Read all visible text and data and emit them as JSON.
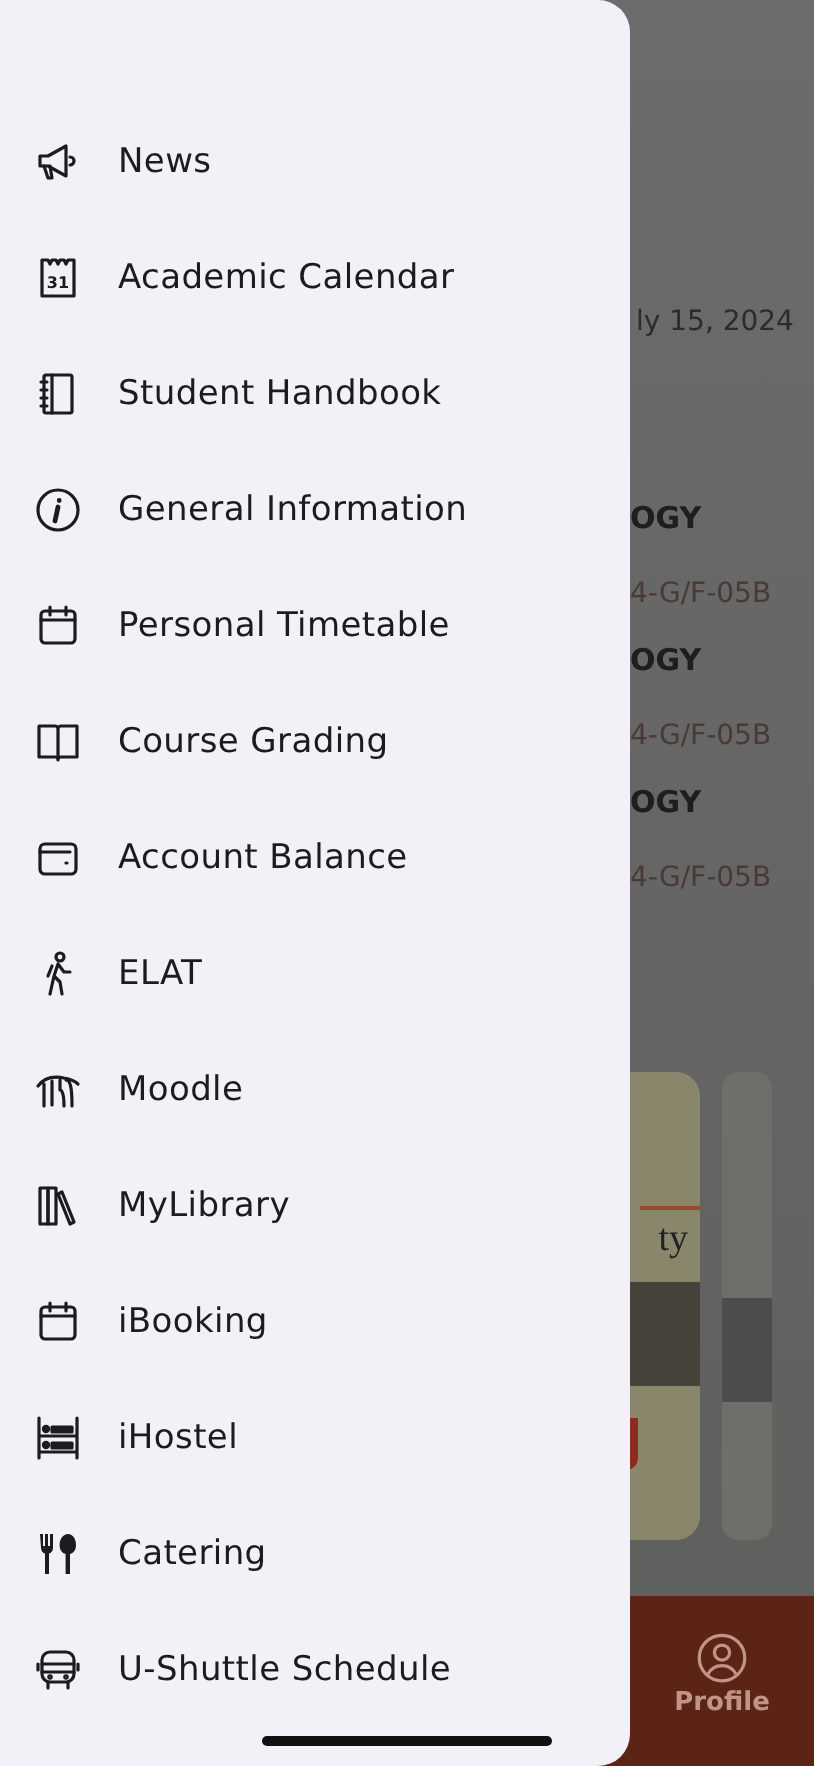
{
  "menu": {
    "items": [
      {
        "label": "News"
      },
      {
        "label": "Academic Calendar",
        "icon_text": "31"
      },
      {
        "label": "Student Handbook"
      },
      {
        "label": "General Information"
      },
      {
        "label": "Personal Timetable"
      },
      {
        "label": "Course Grading"
      },
      {
        "label": "Account Balance"
      },
      {
        "label": "ELAT"
      },
      {
        "label": "Moodle"
      },
      {
        "label": "MyLibrary"
      },
      {
        "label": "iBooking"
      },
      {
        "label": "iHostel"
      },
      {
        "label": "Catering"
      },
      {
        "label": "U-Shuttle Schedule"
      }
    ]
  },
  "background": {
    "date": "ly 15, 2024",
    "courses": [
      {
        "title": "OGY",
        "room": "4-G/F-05B"
      },
      {
        "title": "OGY",
        "room": "4-G/F-05B"
      },
      {
        "title": "OGY",
        "room": "4-G/F-05B"
      }
    ],
    "cards": [
      {
        "text": "ty"
      }
    ],
    "tab_bar": {
      "items": [
        {
          "label": "Profile"
        }
      ]
    }
  }
}
